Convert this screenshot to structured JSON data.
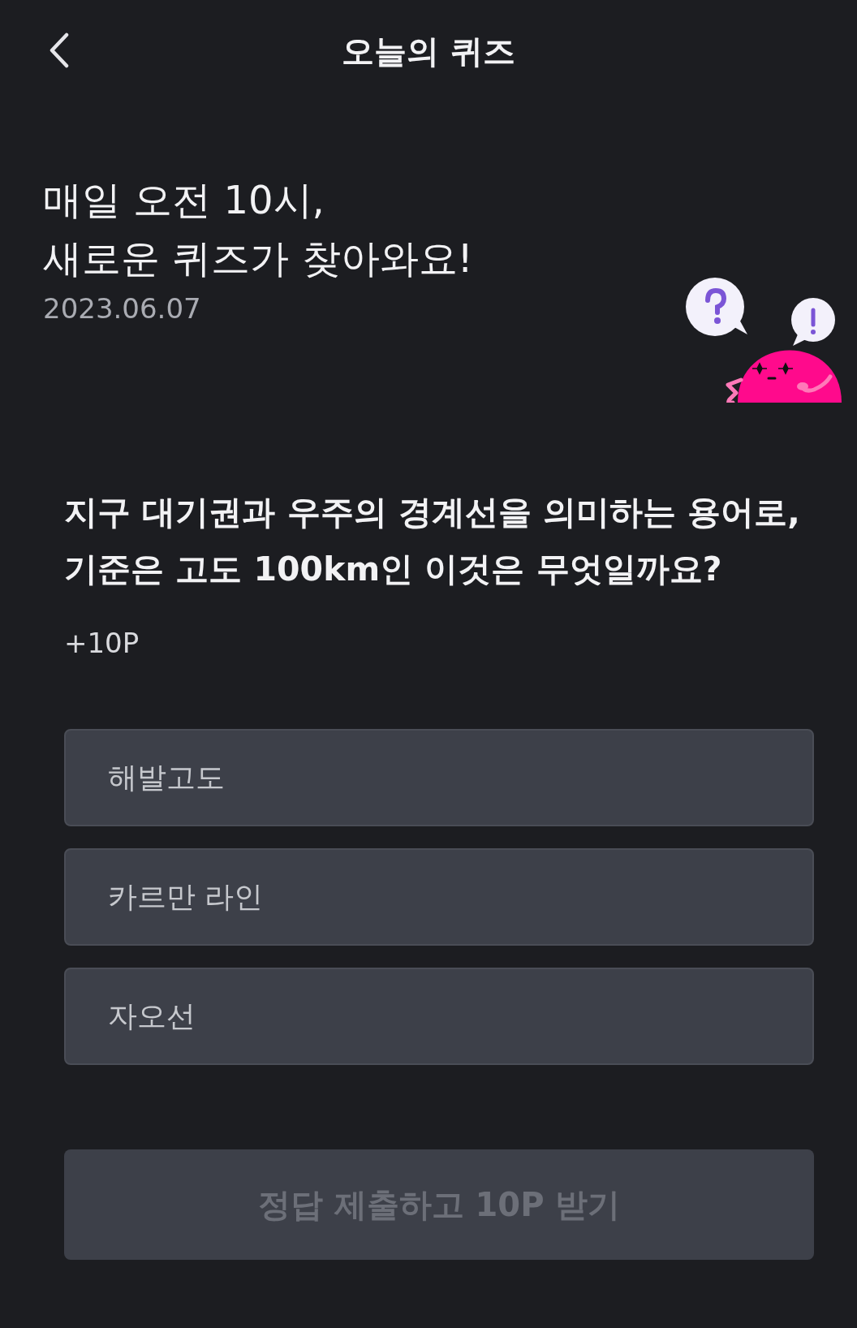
{
  "header": {
    "title": "오늘의 퀴즈"
  },
  "intro": {
    "lines": [
      "매일 오전 10시,",
      "새로운 퀴즈가 찾아와요!"
    ],
    "date": "2023.06.07"
  },
  "question": {
    "lines": [
      "지구 대기권과 우주의 경계선을 의미하는 용어로,",
      "기준은 고도 100km인 이것은 무엇일까요?"
    ],
    "reward": "+10P"
  },
  "options": [
    {
      "label": "해발고도",
      "selected": false
    },
    {
      "label": "카르만 라인",
      "selected": false
    },
    {
      "label": "자오선",
      "selected": false
    }
  ],
  "submit": {
    "label": "정답 제출하고 10P 받기",
    "disabled": true
  }
}
